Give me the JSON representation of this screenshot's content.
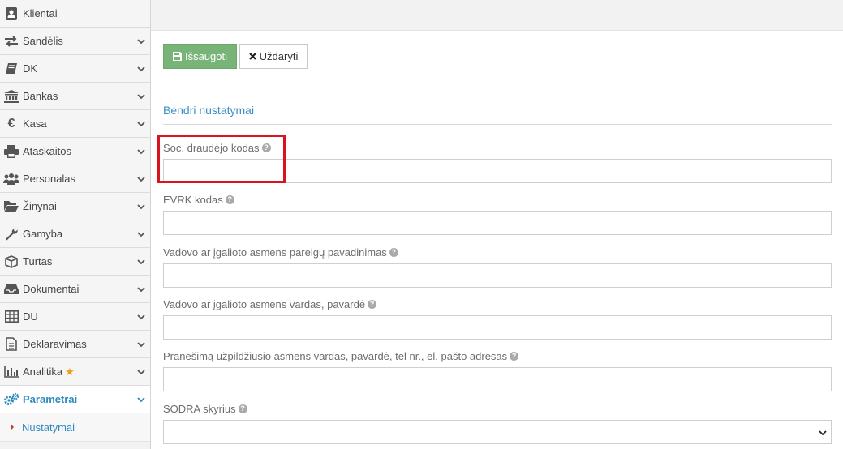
{
  "sidebar": {
    "items": [
      {
        "label": "Klientai",
        "icon": "contact-icon",
        "chevron": false
      },
      {
        "label": "Sandėlis",
        "icon": "transfer-arrows-icon",
        "chevron": true
      },
      {
        "label": "DK",
        "icon": "book-icon",
        "chevron": true
      },
      {
        "label": "Bankas",
        "icon": "bank-icon",
        "chevron": true
      },
      {
        "label": "Kasa",
        "icon": "euro-icon",
        "chevron": true
      },
      {
        "label": "Ataskaitos",
        "icon": "printer-icon",
        "chevron": true
      },
      {
        "label": "Personalas",
        "icon": "users-icon",
        "chevron": true
      },
      {
        "label": "Žinynai",
        "icon": "folder-open-icon",
        "chevron": true
      },
      {
        "label": "Gamyba",
        "icon": "wrench-icon",
        "chevron": true
      },
      {
        "label": "Turtas",
        "icon": "cube-icon",
        "chevron": true
      },
      {
        "label": "Dokumentai",
        "icon": "inbox-icon",
        "chevron": true
      },
      {
        "label": "DU",
        "icon": "table-icon",
        "chevron": true
      },
      {
        "label": "Deklaravimas",
        "icon": "document-icon",
        "chevron": true
      },
      {
        "label": "Analitika",
        "icon": "bar-chart-icon",
        "chevron": true,
        "star": "★"
      },
      {
        "label": "Parametrai",
        "icon": "gears-icon",
        "chevron": true,
        "active": true
      }
    ],
    "subitem": {
      "label": "Nustatymai"
    }
  },
  "toolbar": {
    "save_label": "Išsaugoti",
    "close_label": "Uždaryti"
  },
  "section": {
    "title": "Bendri nustatymai"
  },
  "fields": [
    {
      "label": "Soc. draudėjo kodas",
      "value": "",
      "type": "text"
    },
    {
      "label": "EVRK kodas",
      "value": "",
      "type": "text"
    },
    {
      "label": "Vadovo ar įgalioto asmens pareigų pavadinimas",
      "value": "",
      "type": "text"
    },
    {
      "label": "Vadovo ar įgalioto asmens vardas, pavardė",
      "value": "",
      "type": "text"
    },
    {
      "label": "Pranešimą užpildžiusio asmens vardas, pavardė, tel nr., el. pašto adresas",
      "value": "",
      "type": "text"
    },
    {
      "label": "SODRA skyrius",
      "value": "",
      "type": "select"
    }
  ],
  "help_glyph": "?",
  "colors": {
    "accent": "#2f8ac0",
    "save_button": "#78b478",
    "highlight": "#d9141f",
    "star": "#f39c12"
  }
}
